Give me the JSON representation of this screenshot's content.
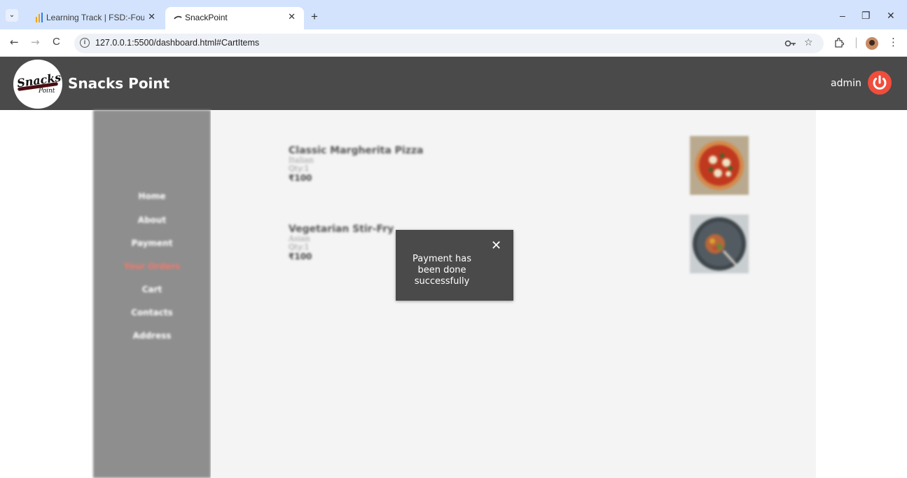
{
  "browser": {
    "tabs": [
      {
        "title": "Learning Track | FSD:-Foundatio",
        "close": "✕"
      },
      {
        "title": "SnackPoint",
        "close": "✕"
      }
    ],
    "new_tab": "+",
    "url": "127.0.0.1:5500/dashboard.html#CartItems",
    "nav": {
      "back": "←",
      "forward": "→",
      "reload": "C"
    },
    "window": {
      "minimize": "–",
      "restore": "❐",
      "close": "✕"
    },
    "icons": [
      "password-key-icon",
      "bookmark-star-icon",
      "extensions-icon",
      "profile-avatar-icon",
      "more-vert-icon"
    ]
  },
  "app": {
    "logo": {
      "line1": "Snacks",
      "line2": "Point"
    },
    "brand": "Snacks Point",
    "user": "admin",
    "accent": "#f04d3c",
    "header_bg": "#4a4a4a"
  },
  "sidebar": {
    "items": [
      {
        "label": "Home",
        "active": false
      },
      {
        "label": "About",
        "active": false
      },
      {
        "label": "Payment",
        "active": false
      },
      {
        "label": "Your Orders",
        "active": true
      },
      {
        "label": "Cart",
        "active": false
      },
      {
        "label": "Contacts",
        "active": false
      },
      {
        "label": "Address",
        "active": false
      }
    ]
  },
  "cart": {
    "items": [
      {
        "name": "Classic Margherita Pizza",
        "category": "Italian",
        "qty": "Qty:1",
        "price": "₹100",
        "image": "pizza-photo"
      },
      {
        "name": "Vegetarian Stir-Fry",
        "category": "Asian",
        "qty": "Qty:1",
        "price": "₹100",
        "image": "stir-fry-bowl-photo"
      }
    ]
  },
  "toast": {
    "message": "Payment has been done successfully",
    "close": "✕"
  }
}
